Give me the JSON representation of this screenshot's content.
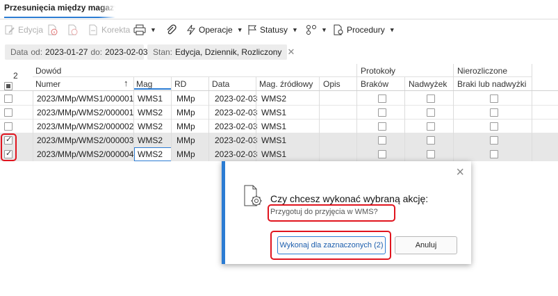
{
  "tab": {
    "title": "Przesunięcia między magazynami"
  },
  "toolbar": {
    "edit": "Edycja",
    "correction": "Korekta",
    "operations": "Operacje",
    "statuses": "Statusy",
    "procedures": "Procedury"
  },
  "filters": {
    "date_label": "Data",
    "from_label": "od:",
    "from_value": "2023-01-27",
    "to_label": "do:",
    "to_value": "2023-02-03",
    "status_label": "Stan:",
    "status_value": "Edycja, Dziennik, Rozliczony"
  },
  "grid": {
    "selected_count": "2",
    "groups": {
      "document": "Dowód",
      "protocols": "Protokoły",
      "uncounted": "Nierozliczone"
    },
    "columns": {
      "number": "Numer",
      "mag": "Mag",
      "rd": "RD",
      "date": "Data",
      "source": "Mag. źródłowy",
      "desc": "Opis",
      "shortages": "Braków",
      "surplus": "Nadwyżek",
      "shortage_or_surplus": "Braki lub nadwyżki"
    },
    "rows": [
      {
        "checked": false,
        "number": "2023/MMp/WMS1/000001",
        "mag": "WMS1",
        "rd": "MMp",
        "date": "2023-02-03",
        "source": "WMS2",
        "desc": ""
      },
      {
        "checked": false,
        "number": "2023/MMp/WMS2/000001",
        "mag": "WMS2",
        "rd": "MMp",
        "date": "2023-02-03",
        "source": "WMS1",
        "desc": ""
      },
      {
        "checked": false,
        "number": "2023/MMp/WMS2/000002",
        "mag": "WMS2",
        "rd": "MMp",
        "date": "2023-02-03",
        "source": "WMS1",
        "desc": ""
      },
      {
        "checked": true,
        "number": "2023/MMp/WMS2/000003",
        "mag": "WMS2",
        "rd": "MMp",
        "date": "2023-02-03",
        "source": "WMS1",
        "desc": ""
      },
      {
        "checked": true,
        "number": "2023/MMp/WMS2/000004",
        "mag": "WMS2",
        "rd": "MMp",
        "date": "2023-02-03",
        "source": "WMS1",
        "desc": ""
      }
    ]
  },
  "dialog": {
    "title": "Czy chcesz wykonać wybraną akcję:",
    "message": "Przygotuj do przyjęcia w WMS?",
    "execute_button": "Wykonaj dla zaznaczonych (2)",
    "cancel_button": "Anuluj",
    "close_symbol": "×"
  },
  "colors": {
    "accent": "#2b7cd3",
    "highlight": "#e0141e",
    "selected_row": "#e7e7e7"
  }
}
